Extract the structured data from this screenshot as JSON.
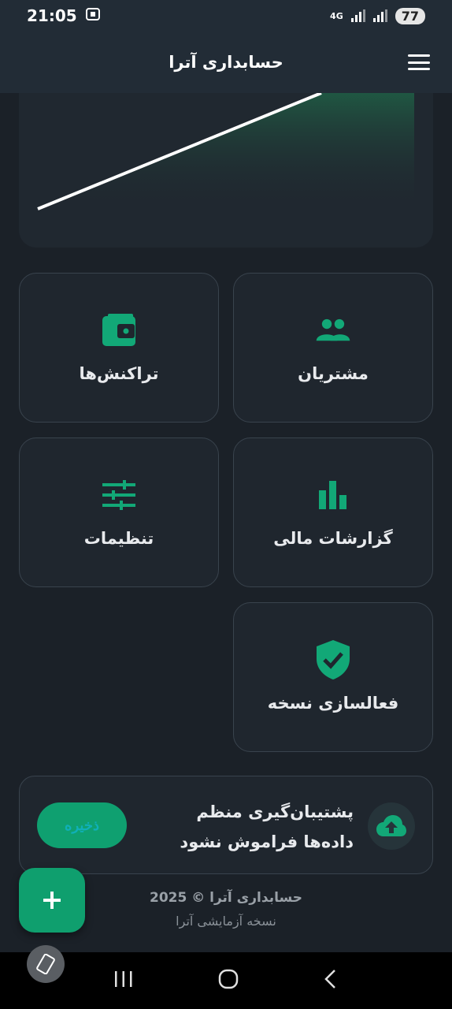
{
  "status_bar": {
    "time": "21:05",
    "network": "4G",
    "battery": "77"
  },
  "app_bar": {
    "title": "حسابداری آترا"
  },
  "tiles": [
    {
      "label": "مشتریان",
      "icon": "people-icon"
    },
    {
      "label": "تراکنش‌ها",
      "icon": "wallet-icon"
    },
    {
      "label": "گزارشات مالی",
      "icon": "bar-chart-icon"
    },
    {
      "label": "تنظیمات",
      "icon": "sliders-icon"
    },
    {
      "label": "فعالسازی نسخه",
      "icon": "shield-check-icon"
    }
  ],
  "backup": {
    "title": "پشتیبان‌گیری منظم",
    "subtitle": "داده‌ها فراموش نشود",
    "button_label": "ذخیره",
    "icon": "cloud-upload-icon"
  },
  "footer": {
    "copyright": "حسابداری آترا © 2025",
    "version": "نسخه آزمایشی آترا"
  },
  "colors": {
    "accent": "#12a877",
    "background": "#1b2128",
    "card": "#1f262e",
    "header": "#222c36"
  }
}
